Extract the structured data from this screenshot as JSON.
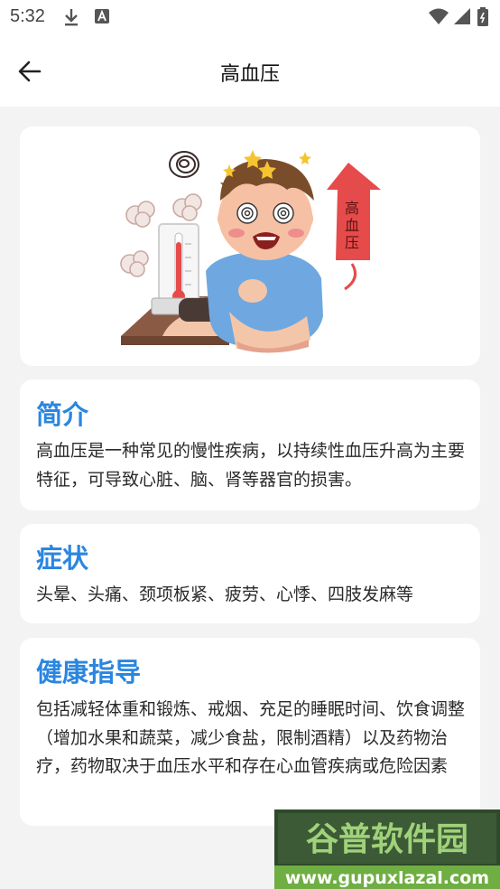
{
  "status": {
    "time": "5:32"
  },
  "appbar": {
    "title": "高血压"
  },
  "illustration": {
    "sign_text": "高血压"
  },
  "intro": {
    "heading": "简介",
    "body": "高血压是一种常见的慢性疾病，以持续性血压升高为主要特征，可导致心脏、脑、肾等器官的损害。"
  },
  "symptoms": {
    "heading": "症状",
    "body": "头晕、头痛、颈项板紧、疲劳、心悸、四肢发麻等"
  },
  "guidance": {
    "heading": "健康指导",
    "body": "包括减轻体重和锻炼、戒烟、充足的睡眠时间、饮食调整 （增加水果和蔬菜，减少食盐，限制酒精）以及药物治疗，药物取决于血压水平和存在心血管疾病或危险因素"
  },
  "watermark": {
    "title": "谷普软件园",
    "url": "www.gupuxlazal.com"
  },
  "colors": {
    "heading": "#2a86e0",
    "accent_red": "#e64b4b"
  }
}
